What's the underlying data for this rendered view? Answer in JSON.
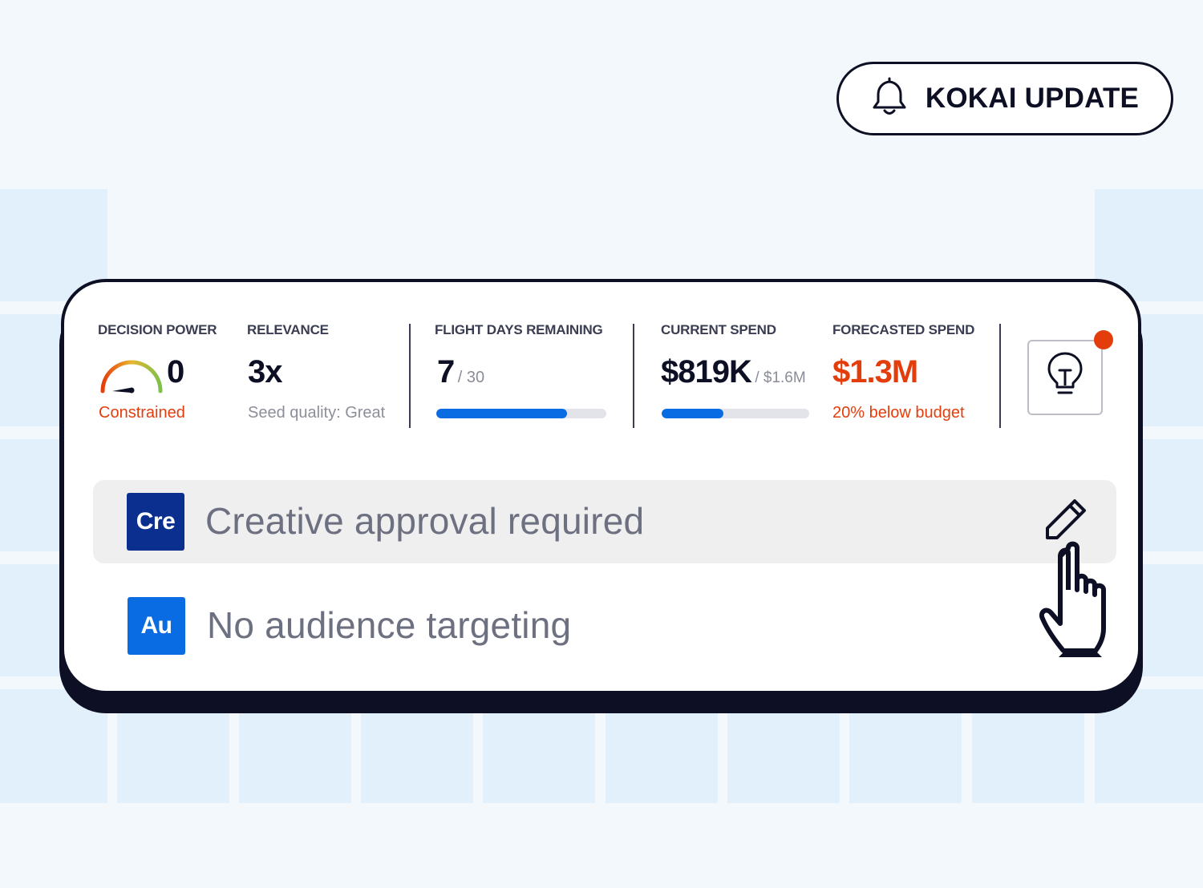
{
  "notification": {
    "label": "KOKAI UPDATE",
    "icon": "bell-icon"
  },
  "metrics": {
    "decision_power": {
      "label": "DECISION POWER",
      "value": "0",
      "status": "Constrained",
      "icon": "gauge-icon"
    },
    "relevance": {
      "label": "RELEVANCE",
      "value": "3x",
      "note": "Seed quality: Great"
    },
    "flight_days": {
      "label": "FLIGHT DAYS REMAINING",
      "value": "7",
      "total": "/ 30",
      "progress": 0.77
    },
    "current_spend": {
      "label": "CURRENT SPEND",
      "value": "$819K",
      "total": "/ $1.6M",
      "progress": 0.42
    },
    "forecasted_spend": {
      "label": "FORECASTED SPEND",
      "value": "$1.3M",
      "note": "20% below budget"
    }
  },
  "insights": {
    "icon": "lightbulb-icon",
    "has_notification": true
  },
  "tasks": [
    {
      "badge": "Cre",
      "badge_color": "#0a2f8f",
      "text": "Creative approval required",
      "action_icon": "pencil-icon",
      "highlighted": true
    },
    {
      "badge": "Au",
      "badge_color": "#0a6ce2",
      "text": "No audience targeting",
      "highlighted": false
    }
  ],
  "colors": {
    "accent": "#0a6ce2",
    "warning": "#e43d0c",
    "ink": "#0d0f24"
  }
}
